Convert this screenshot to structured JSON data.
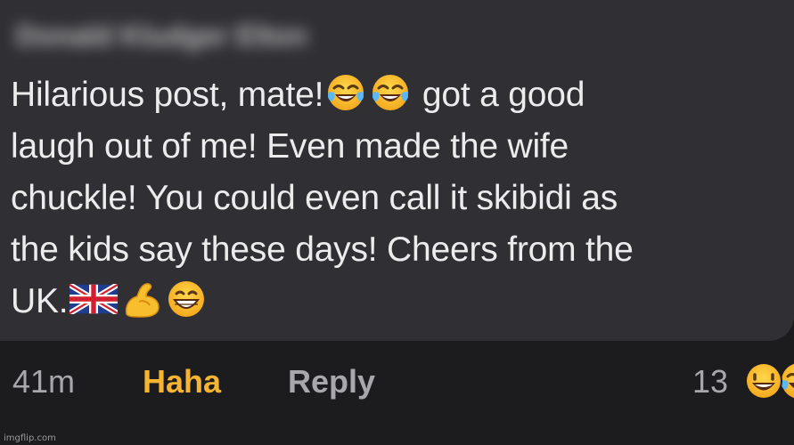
{
  "comment": {
    "author_name": "Donald Kludger Elton",
    "lines": [
      {
        "parts": [
          "Hilarious post, mate!",
          " got a good"
        ]
      },
      {
        "text": "laugh out of me! Even made the wife"
      },
      {
        "text": "chuckle! You could even call it skibidi as"
      },
      {
        "text": "the kids say these days! Cheers from the"
      },
      {
        "text": "UK."
      }
    ],
    "inline_emojis": [
      "tears-of-joy-icon",
      "tears-of-joy-icon",
      "uk-flag-icon",
      "flexed-biceps-icon",
      "grinning-face-icon"
    ]
  },
  "footer": {
    "timestamp": "41m",
    "haha_label": "Haha",
    "reply_label": "Reply",
    "reaction_count": "13",
    "reaction_icons": [
      "grinning-face-icon",
      "tears-of-joy-icon"
    ]
  },
  "colors": {
    "bubble_bg": "#303034",
    "page_bg": "#1c1c1e",
    "text": "#ececec",
    "haha_active": "#f5b533",
    "muted": "#a8a8ac"
  },
  "watermark": "imgflip.com"
}
